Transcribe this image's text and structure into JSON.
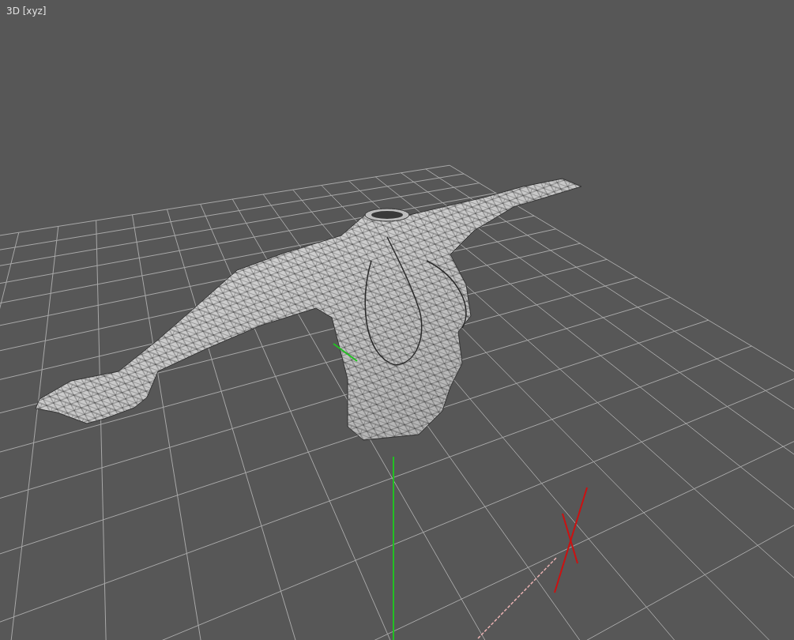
{
  "viewport": {
    "title": "3D [xyz]"
  }
}
